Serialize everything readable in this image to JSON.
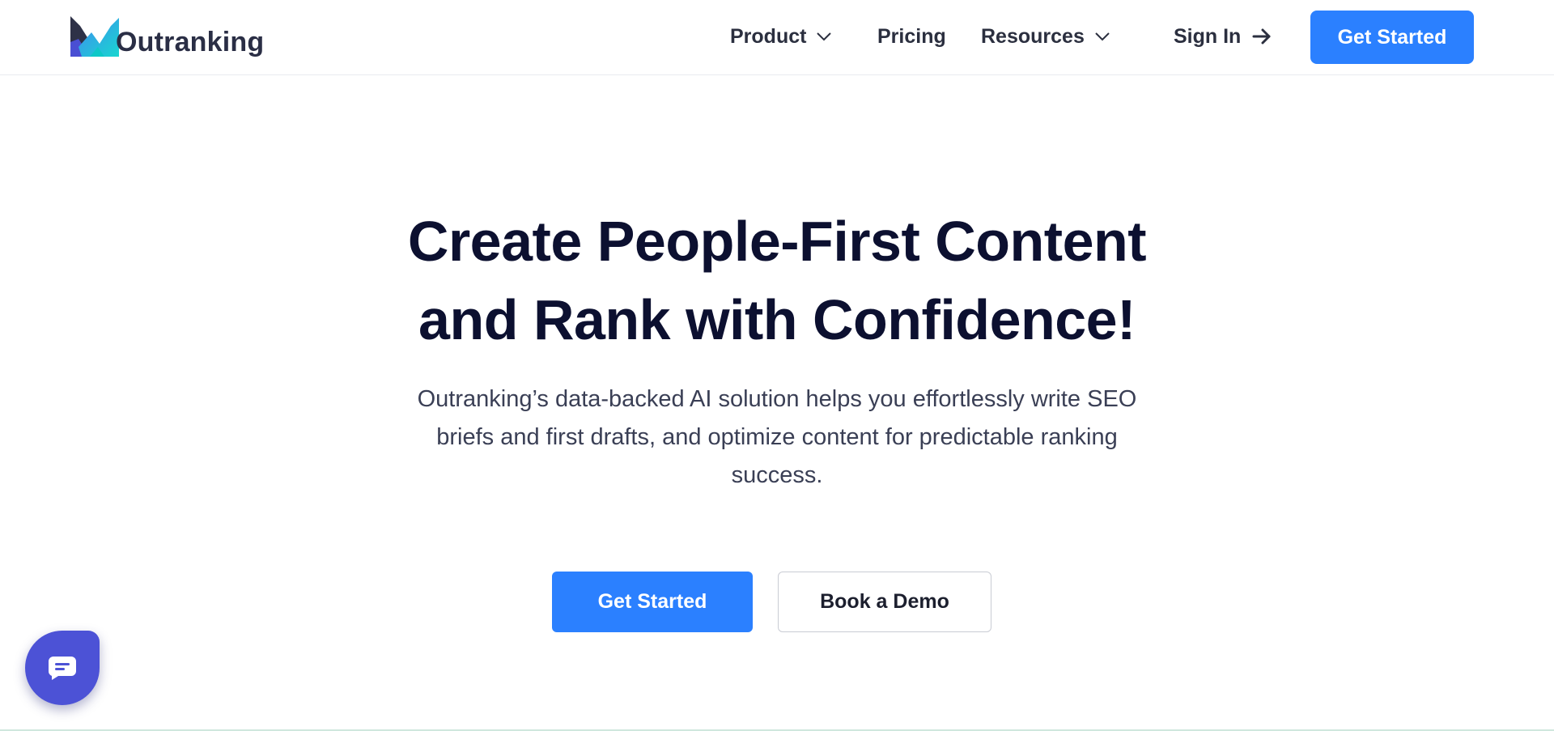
{
  "brand": {
    "name": "Outranking",
    "colors": {
      "primary_button": "#2b80ff",
      "chat_widget": "#4c52d6",
      "heading": "#0c1030"
    }
  },
  "nav": {
    "items": [
      {
        "label": "Product",
        "icon": "chevron-down-icon"
      },
      {
        "label": "Pricing"
      },
      {
        "label": "Resources",
        "icon": "chevron-down-icon"
      }
    ],
    "sign_in": {
      "label": "Sign In",
      "icon": "arrow-right-icon"
    },
    "cta": {
      "label": "Get Started"
    }
  },
  "hero": {
    "title_lines": [
      "Create People-First Content",
      "and Rank with Confidence!"
    ],
    "subtitle_lines": [
      "Outranking’s data-backed AI solution helps you effortlessly write SEO",
      "briefs and first drafts, and optimize content for predictable ranking",
      "success."
    ],
    "primary_cta": "Get Started",
    "secondary_cta": "Book a Demo"
  },
  "chat_widget": {
    "icon": "chat-icon"
  }
}
